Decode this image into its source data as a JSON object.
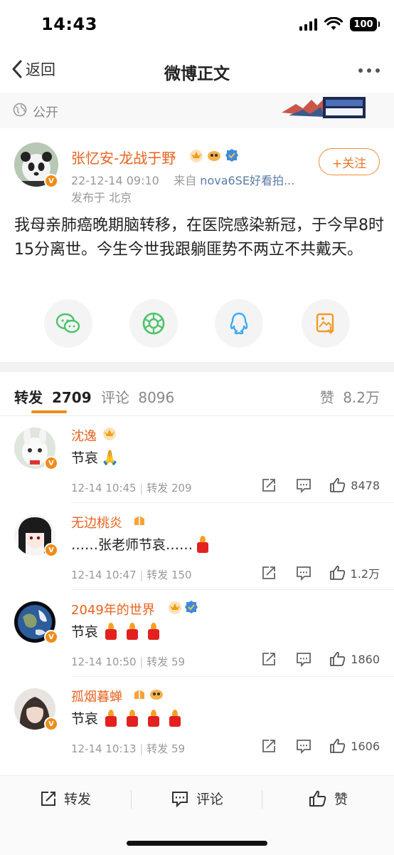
{
  "status": {
    "time": "14:43",
    "battery": "100"
  },
  "nav": {
    "back_label": "返回",
    "title": "微博正文"
  },
  "visibility": {
    "label": "公开"
  },
  "post": {
    "author": "张忆安-龙战于野",
    "timestamp": "22-12-14 09:10",
    "source_prefix": "来自",
    "source": "nova6SE好看拍...",
    "location": "发布于 北京",
    "follow_label": "+关注",
    "text": "我母亲肺癌晚期脑转移，在医院感染新冠，于今早8时15分离世。今生今世我跟躺匪势不两立不共戴天。"
  },
  "share_targets": [
    "wechat-icon",
    "moments-icon",
    "qq-icon",
    "save-image-icon"
  ],
  "tabs": {
    "repost_label": "转发",
    "repost_count": "2709",
    "comment_label": "评论",
    "comment_count": "8096",
    "like_label": "赞",
    "like_count": "8.2万"
  },
  "comments": [
    {
      "name": "沈逸",
      "text": "节哀",
      "emoji": "folded-hands",
      "time": "12-14 10:45",
      "repost": "转发 209",
      "likes": "8478"
    },
    {
      "name": "无边桃炎",
      "text": "……张老师节哀……",
      "emoji": "candle-1",
      "time": "12-14 10:47",
      "repost": "转发 150",
      "likes": "1.2万"
    },
    {
      "name": "2049年的世界",
      "text": "节哀",
      "emoji": "candle-3",
      "time": "12-14 10:50",
      "repost": "转发 59",
      "likes": "1860"
    },
    {
      "name": "孤烟暮蝉",
      "text": "节哀",
      "emoji": "candle-4",
      "time": "12-14 10:13",
      "repost": "转发 59",
      "likes": "1606"
    }
  ],
  "bottom_bar": {
    "repost": "转发",
    "comment": "评论",
    "like": "赞"
  },
  "colors": {
    "accent": "#f08c1a",
    "name": "#e8621f",
    "candle": "#e3211e"
  }
}
